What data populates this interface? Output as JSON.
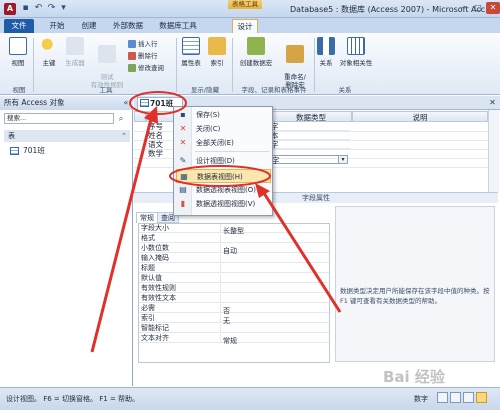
{
  "title_bar": {
    "app_icon": "A",
    "context_tab_label": "表格工具",
    "title": "Database5 : 数据库 (Access 2007) - Microsoft Acc...",
    "controls": [
      "—",
      "□",
      "✕"
    ]
  },
  "ribbon_tabs": [
    {
      "label": "文件"
    },
    {
      "label": "开始"
    },
    {
      "label": "创建"
    },
    {
      "label": "外部数据"
    },
    {
      "label": "数据库工具"
    },
    {
      "label": "设计"
    }
  ],
  "ribbon": {
    "view_label": "视图",
    "primary_key_label": "主键",
    "builder_label": "生成器",
    "test_rules_label": "测试\n有效性规则",
    "insert_row_label": "插入行",
    "delete_row_label": "删除行",
    "modify_lookups_label": "修改查阅",
    "property_sheet_label": "属性表",
    "indexes_label": "索引",
    "create_macros_label": "创建数据宏",
    "rename_delete_macro_label": "重命名/\n删除宏",
    "relationships_label": "关系",
    "object_dependencies_label": "对象相关性",
    "groups": {
      "view": "视图",
      "tools": "工具",
      "show_hide": "显示/隐藏",
      "field_record_events": "字段、记录和表格事件",
      "relationships": "关系"
    }
  },
  "nav_pane": {
    "header": "所有 Access 对象",
    "collapse": "«",
    "search_placeholder": "搜索...",
    "category": "表",
    "items": [
      {
        "label": "701班"
      }
    ]
  },
  "document": {
    "tab_label": "701班",
    "columns": {
      "field_name": "",
      "data_type": "数据类型",
      "description": "说明"
    },
    "fields": [
      {
        "name": "序号",
        "type": "字"
      },
      {
        "name": "姓名",
        "type": "本"
      },
      {
        "name": "语文",
        "type": "字"
      },
      {
        "name": "数学",
        "type": "字"
      }
    ],
    "field_props_label": "字段属性"
  },
  "context_menu": {
    "items": [
      {
        "label": "保存(S)",
        "icon": "save-icon"
      },
      {
        "label": "关闭(C)",
        "icon": "close-icon"
      },
      {
        "label": "全部关闭(E)",
        "icon": "close-all-icon"
      },
      {
        "label": "设计视图(D)",
        "icon": "design-view-icon"
      },
      {
        "label": "数据表视图(H)",
        "icon": "datasheet-view-icon"
      },
      {
        "label": "数据透视表视图(O)",
        "icon": "pivot-table-icon"
      },
      {
        "label": "数据透视图视图(V)",
        "icon": "pivot-chart-icon"
      }
    ]
  },
  "properties": {
    "tabs": [
      {
        "label": "常规"
      },
      {
        "label": "查阅"
      }
    ],
    "rows": [
      {
        "name": "字段大小",
        "value": "长整型"
      },
      {
        "name": "格式",
        "value": ""
      },
      {
        "name": "小数位数",
        "value": "自动"
      },
      {
        "name": "输入掩码",
        "value": ""
      },
      {
        "name": "标题",
        "value": ""
      },
      {
        "name": "默认值",
        "value": ""
      },
      {
        "name": "有效性规则",
        "value": ""
      },
      {
        "name": "有效性文本",
        "value": ""
      },
      {
        "name": "必需",
        "value": "否"
      },
      {
        "name": "索引",
        "value": "无"
      },
      {
        "name": "智能标记",
        "value": ""
      },
      {
        "name": "文本对齐",
        "value": "常规"
      }
    ],
    "help_text": "数据类型决定用户所能保存在该字段中值的种类。按 F1 键可查看有关数据类型的帮助。"
  },
  "status_bar": {
    "text": "设计视图。 F6 = 切换窗格。 F1 = 帮助。",
    "numlock": "数字"
  },
  "watermark": "Bai 经验",
  "colors": {
    "accent": "#1f5ba6",
    "annotation": "#e0302a",
    "highlight": "#fbe7ad"
  }
}
